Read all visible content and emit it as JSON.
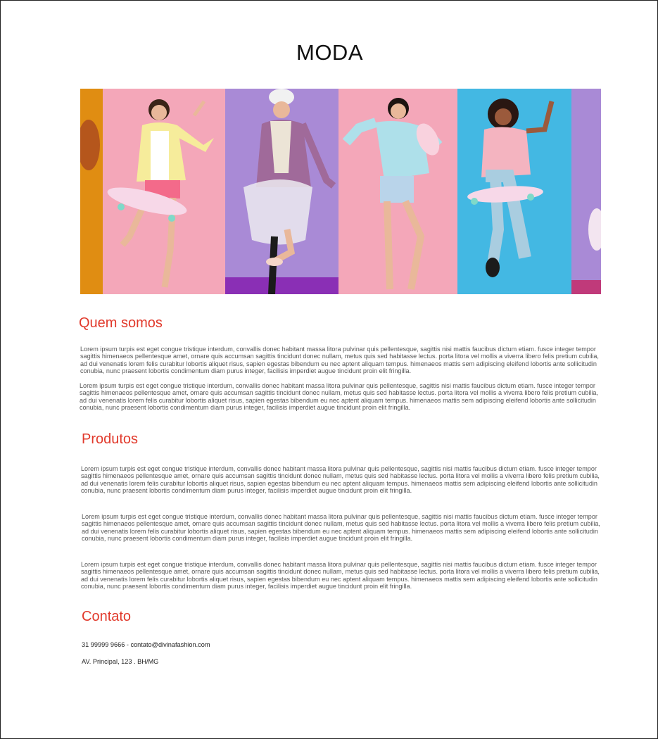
{
  "header": {
    "title": "MODA"
  },
  "sections": {
    "about": {
      "title": "Quem somos",
      "paragraphs": [
        "Lorem ipsum turpis est eget congue tristique interdum, convallis donec habitant massa litora pulvinar quis pellentesque, sagittis nisi mattis faucibus dictum etiam. fusce integer tempor sagittis himenaeos pellentesque amet, ornare quis accumsan sagittis tincidunt donec nullam, metus quis sed habitasse lectus. porta litora vel mollis a viverra libero felis pretium cubilia, ad dui venenatis lorem felis curabitur lobortis aliquet risus, sapien egestas bibendum eu nec aptent aliquam tempus. himenaeos mattis sem adipiscing eleifend lobortis ante sollicitudin conubia, nunc praesent lobortis condimentum diam purus integer, facilisis imperdiet augue tincidunt proin elit fringilla.",
        "Lorem ipsum turpis est eget congue tristique interdum, convallis donec habitant massa litora pulvinar quis pellentesque, sagittis nisi mattis faucibus dictum etiam. fusce integer tempor sagittis himenaeos pellentesque amet, ornare quis accumsan sagittis tincidunt donec nullam, metus quis sed habitasse lectus. porta litora vel mollis a viverra libero felis pretium cubilia, ad dui venenatis lorem felis curabitur lobortis aliquet risus, sapien egestas bibendum eu nec aptent aliquam tempus. himenaeos mattis sem adipiscing eleifend lobortis ante sollicitudin conubia, nunc praesent lobortis condimentum diam purus integer, facilisis imperdiet augue tincidunt proin elit fringilla."
      ]
    },
    "products": {
      "title": "Produtos",
      "paragraphs": [
        "Lorem ipsum turpis est eget congue tristique interdum, convallis donec habitant massa litora pulvinar quis pellentesque, sagittis nisi mattis faucibus dictum etiam. fusce integer tempor sagittis himenaeos pellentesque amet, ornare quis accumsan sagittis tincidunt donec nullam, metus quis sed habitasse lectus. porta litora vel mollis a viverra libero felis pretium cubilia, ad dui venenatis lorem felis curabitur lobortis aliquet risus, sapien egestas bibendum eu nec aptent aliquam tempus. himenaeos mattis sem adipiscing eleifend lobortis ante sollicitudin conubia, nunc praesent lobortis condimentum diam purus integer, facilisis imperdiet augue tincidunt proin elit fringilla.",
        "Lorem ipsum turpis est eget congue tristique interdum, convallis donec habitant massa litora pulvinar quis pellentesque, sagittis nisi mattis faucibus dictum etiam. fusce integer tempor sagittis himenaeos pellentesque amet, ornare quis accumsan sagittis tincidunt donec nullam, metus quis sed habitasse lectus. porta litora vel mollis a viverra libero felis pretium cubilia, ad dui venenatis lorem felis curabitur lobortis aliquet risus, sapien egestas bibendum eu nec aptent aliquam tempus. himenaeos mattis sem adipiscing eleifend lobortis ante sollicitudin conubia, nunc praesent lobortis condimentum diam purus integer, facilisis imperdiet augue tincidunt proin elit fringilla.",
        "Lorem ipsum turpis est eget congue tristique interdum, convallis donec habitant massa litora pulvinar quis pellentesque, sagittis nisi mattis faucibus dictum etiam. fusce integer tempor sagittis himenaeos pellentesque amet, ornare quis accumsan sagittis tincidunt donec nullam, metus quis sed habitasse lectus. porta litora vel mollis a viverra libero felis pretium cubilia, ad dui venenatis lorem felis curabitur lobortis aliquet risus, sapien egestas bibendum eu nec aptent aliquam tempus. himenaeos mattis sem adipiscing eleifend lobortis ante sollicitudin conubia, nunc praesent lobortis condimentum diam purus integer, facilisis imperdiet augue tincidunt proin elit fringilla."
      ]
    },
    "contact": {
      "title": "Contato",
      "phone_email": "31 99999 9666 - contato@divinafashion.com",
      "address": "AV. Principal, 123 . BH/MG"
    }
  },
  "colors": {
    "accent": "#e1392b",
    "body_text": "#555555",
    "hero_panels": [
      "#e08d12",
      "#f4a7b9",
      "#a98ad6",
      "#f4a7b9",
      "#43b8e3",
      "#a98ad6"
    ]
  }
}
